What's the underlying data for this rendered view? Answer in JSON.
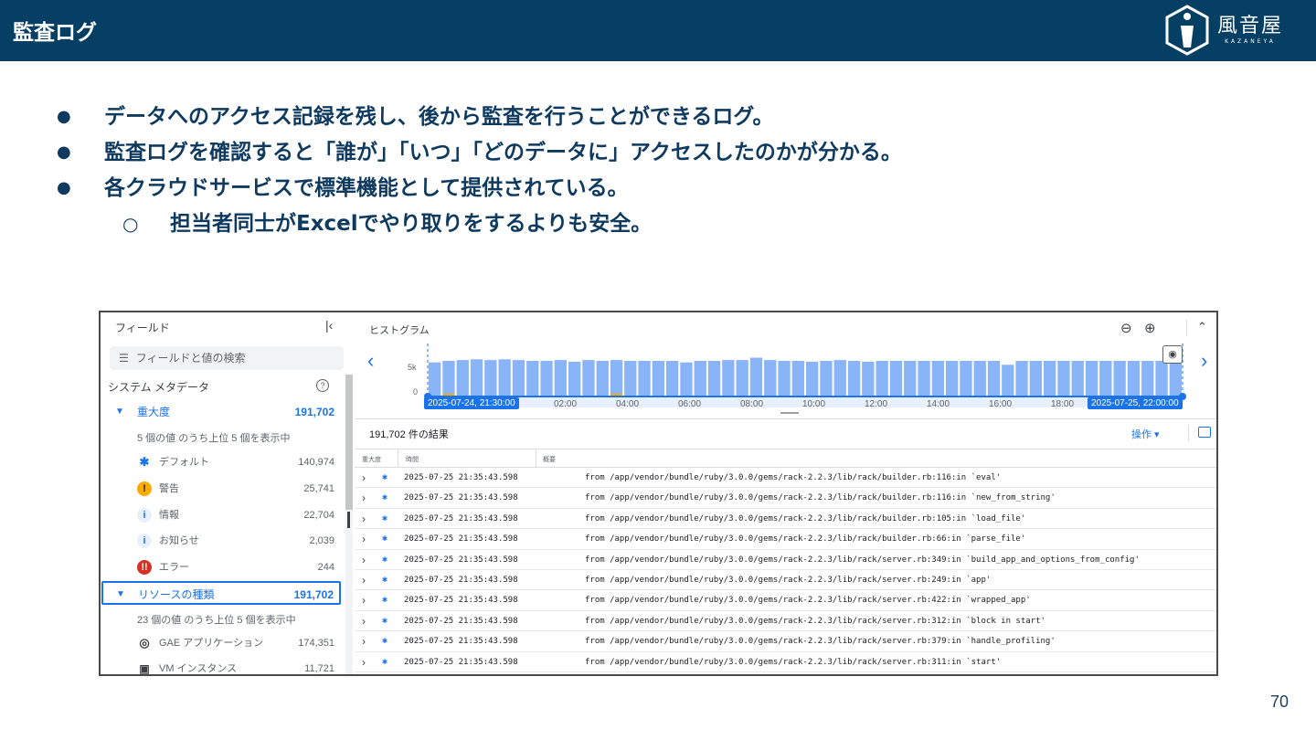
{
  "header": {
    "title": "監査ログ",
    "logo_text": "風音屋",
    "logo_sub": "KAZANEYA"
  },
  "bullets": [
    {
      "text": "データへのアクセス記録を残し、後から監査を行うことができるログ。"
    },
    {
      "text": "監査ログを確認すると「誰が」「いつ」「どのデータに」アクセスしたのかが分かる。"
    },
    {
      "text": "各クラウドサービスで標準機能として提供されている。"
    }
  ],
  "sub_bullet": {
    "text": "担当者同士がExcelでやり取りをするよりも安全。"
  },
  "bullet_marks": {
    "main": "●",
    "sub": "○"
  },
  "fields_panel": {
    "title": "フィールド",
    "search_placeholder": "フィールドと値の検索",
    "section": "システム メタデータ",
    "severity": {
      "label": "重大度",
      "count": "191,702",
      "note": "5 個の値 のうち上位 5 個を表示中",
      "items": [
        {
          "label": "デフォルト",
          "count": "140,974",
          "icon": "default-icon"
        },
        {
          "label": "警告",
          "count": "25,741",
          "icon": "warning-icon"
        },
        {
          "label": "情報",
          "count": "22,704",
          "icon": "info-icon"
        },
        {
          "label": "お知らせ",
          "count": "2,039",
          "icon": "notice-icon"
        },
        {
          "label": "エラー",
          "count": "244",
          "icon": "error-icon"
        }
      ]
    },
    "resource": {
      "label": "リソースの種類",
      "count": "191,702",
      "note": "23 個の値 のうち上位 5 個を表示中",
      "items": [
        {
          "label": "GAE アプリケーション",
          "count": "174,351",
          "icon": "gae-icon"
        },
        {
          "label": "VM インスタンス",
          "count": "11,721",
          "icon": "vm-icon"
        }
      ]
    }
  },
  "histogram": {
    "title": "ヒストグラム",
    "y_labels": [
      "5k",
      "0"
    ],
    "range_start": "2025-07-24, 21:30:00",
    "range_end": "2025-07-25, 22:00:00",
    "ticks": [
      "02:00",
      "04:00",
      "06:00",
      "08:00",
      "10:00",
      "12:00",
      "14:00",
      "16:00",
      "18:00"
    ],
    "colors": {
      "bar": "#8ab4f8",
      "warn": "#f9ab00",
      "band": "#e8f0fe",
      "accent": "#1a73e8"
    }
  },
  "chart_data": {
    "type": "bar",
    "title": "ヒストグラム",
    "ylim": [
      0,
      6000
    ],
    "values": [
      4300,
      4500,
      4600,
      4700,
      4600,
      4700,
      4600,
      4500,
      4500,
      4600,
      4400,
      4600,
      4500,
      4600,
      4500,
      4500,
      4500,
      4500,
      4300,
      4500,
      4500,
      4600,
      4600,
      4900,
      4600,
      4500,
      4500,
      4400,
      4500,
      4600,
      4500,
      4400,
      4500,
      4500,
      4500,
      4500,
      4500,
      4500,
      4500,
      4500,
      4500,
      4000,
      4500,
      4500,
      4500,
      4500,
      4500,
      4500,
      4500,
      4500,
      4500,
      4500,
      4500,
      4500
    ]
  },
  "results": {
    "count_text": "191,702 件の結果",
    "ops_label": "操作 ▾"
  },
  "table": {
    "headers": [
      "重大度",
      "時間",
      "概要"
    ],
    "rows": [
      {
        "time": "2025-07-25 21:35:43.598",
        "summary": "from /app/vendor/bundle/ruby/3.0.0/gems/rack-2.2.3/lib/rack/builder.rb:116:in `eval'"
      },
      {
        "time": "2025-07-25 21:35:43.598",
        "summary": "from /app/vendor/bundle/ruby/3.0.0/gems/rack-2.2.3/lib/rack/builder.rb:116:in `new_from_string'"
      },
      {
        "time": "2025-07-25 21:35:43.598",
        "summary": "from /app/vendor/bundle/ruby/3.0.0/gems/rack-2.2.3/lib/rack/builder.rb:105:in `load_file'"
      },
      {
        "time": "2025-07-25 21:35:43.598",
        "summary": "from /app/vendor/bundle/ruby/3.0.0/gems/rack-2.2.3/lib/rack/builder.rb:66:in `parse_file'"
      },
      {
        "time": "2025-07-25 21:35:43.598",
        "summary": "from /app/vendor/bundle/ruby/3.0.0/gems/rack-2.2.3/lib/rack/server.rb:349:in `build_app_and_options_from_config'"
      },
      {
        "time": "2025-07-25 21:35:43.598",
        "summary": "from /app/vendor/bundle/ruby/3.0.0/gems/rack-2.2.3/lib/rack/server.rb:249:in `app'"
      },
      {
        "time": "2025-07-25 21:35:43.598",
        "summary": "from /app/vendor/bundle/ruby/3.0.0/gems/rack-2.2.3/lib/rack/server.rb:422:in `wrapped_app'"
      },
      {
        "time": "2025-07-25 21:35:43.598",
        "summary": "from /app/vendor/bundle/ruby/3.0.0/gems/rack-2.2.3/lib/rack/server.rb:312:in `block in start'"
      },
      {
        "time": "2025-07-25 21:35:43.598",
        "summary": "from /app/vendor/bundle/ruby/3.0.0/gems/rack-2.2.3/lib/rack/server.rb:379:in `handle_profiling'"
      },
      {
        "time": "2025-07-25 21:35:43.598",
        "summary": "from /app/vendor/bundle/ruby/3.0.0/gems/rack-2.2.3/lib/rack/server.rb:311:in `start'"
      }
    ]
  },
  "page_number": "70"
}
